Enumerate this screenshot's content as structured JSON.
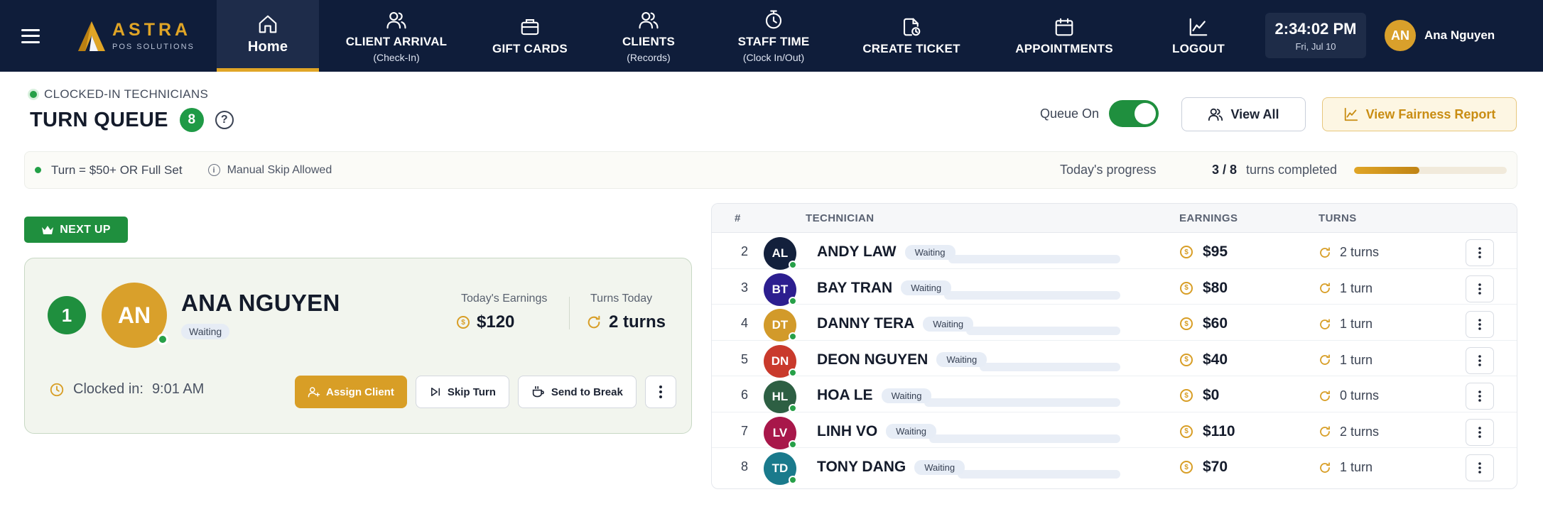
{
  "brand": {
    "name": "ASTRA",
    "sub": "POS SOLUTIONS"
  },
  "nav": [
    {
      "key": "home",
      "label": "Home",
      "sub": "",
      "icon": "home-icon",
      "active": true
    },
    {
      "key": "client-arrival",
      "label": "CLIENT ARRIVAL",
      "sub": "(Check-In)",
      "icon": "users-icon",
      "active": false
    },
    {
      "key": "gift-cards",
      "label": "GIFT CARDS",
      "sub": "",
      "icon": "gift-card-icon",
      "active": false
    },
    {
      "key": "clients",
      "label": "CLIENTS",
      "sub": "(Records)",
      "icon": "users-icon",
      "active": false
    },
    {
      "key": "staff-time",
      "label": "STAFF TIME",
      "sub": "(Clock In/Out)",
      "icon": "stopwatch-icon",
      "active": false
    },
    {
      "key": "create-ticket",
      "label": "CREATE TICKET",
      "sub": "",
      "icon": "ticket-icon",
      "active": false
    },
    {
      "key": "appointments",
      "label": "APPOINTMENTS",
      "sub": "",
      "icon": "calendar-icon",
      "active": false
    },
    {
      "key": "logout",
      "label": "LOGOUT",
      "sub": "",
      "icon": "chart-icon",
      "active": false
    }
  ],
  "clock": {
    "time": "2:34:02 PM",
    "date": "Fri, Jul 10"
  },
  "user": {
    "initials": "AN",
    "name": "Ana Nguyen"
  },
  "header": {
    "subtitle": "CLOCKED-IN TECHNICIANS",
    "title": "TURN QUEUE",
    "count": "8",
    "help": "?"
  },
  "controls": {
    "queue_label": "Queue On",
    "queue_on": true,
    "view_all": "View All",
    "fairness": "View Fairness Report"
  },
  "strip": {
    "rule": "Turn = $50+ OR Full Set",
    "skip": "Manual Skip Allowed",
    "progress_label": "Today's progress",
    "progress_value": "3 / 8",
    "progress_suffix": "turns completed",
    "progress_fraction": 0.43
  },
  "next_up": {
    "tag": "NEXT UP",
    "position": "1",
    "initials": "AN",
    "name": "ANA NGUYEN",
    "status": "Waiting",
    "earnings_label": "Today's Earnings",
    "earnings": "$120",
    "turns_label": "Turns Today",
    "turns": "2 turns",
    "clocked_label": "Clocked in:",
    "clocked_time": "9:01 AM",
    "actions": {
      "assign": "Assign Client",
      "skip": "Skip Turn",
      "break": "Send to Break"
    }
  },
  "table": {
    "headers": {
      "rank": "#",
      "tech": "TECHNICIAN",
      "earnings": "EARNINGS",
      "turns": "TURNS"
    },
    "rows": [
      {
        "rank": "2",
        "initials": "AL",
        "color": "#13203c",
        "name": "ANDY LAW",
        "status": "Waiting",
        "earnings": "$95",
        "turns": "2 turns"
      },
      {
        "rank": "3",
        "initials": "BT",
        "color": "#2c1e8f",
        "name": "BAY TRAN",
        "status": "Waiting",
        "earnings": "$80",
        "turns": "1 turn"
      },
      {
        "rank": "4",
        "initials": "DT",
        "color": "#d29a2a",
        "name": "DANNY TERA",
        "status": "Waiting",
        "earnings": "$60",
        "turns": "1 turn"
      },
      {
        "rank": "5",
        "initials": "DN",
        "color": "#c93a2c",
        "name": "DEON NGUYEN",
        "status": "Waiting",
        "earnings": "$40",
        "turns": "1 turn"
      },
      {
        "rank": "6",
        "initials": "HL",
        "color": "#2d5f43",
        "name": "HOA LE",
        "status": "Waiting",
        "earnings": "$0",
        "turns": "0 turns"
      },
      {
        "rank": "7",
        "initials": "LV",
        "color": "#a8174a",
        "name": "LINH VO",
        "status": "Waiting",
        "earnings": "$110",
        "turns": "2 turns"
      },
      {
        "rank": "8",
        "initials": "TD",
        "color": "#1a7a8c",
        "name": "TONY DANG",
        "status": "Waiting",
        "earnings": "$70",
        "turns": "1 turn"
      }
    ]
  },
  "colors": {
    "navy": "#0f1d3a",
    "gold": "#e0a526",
    "green": "#1f8f3e"
  }
}
